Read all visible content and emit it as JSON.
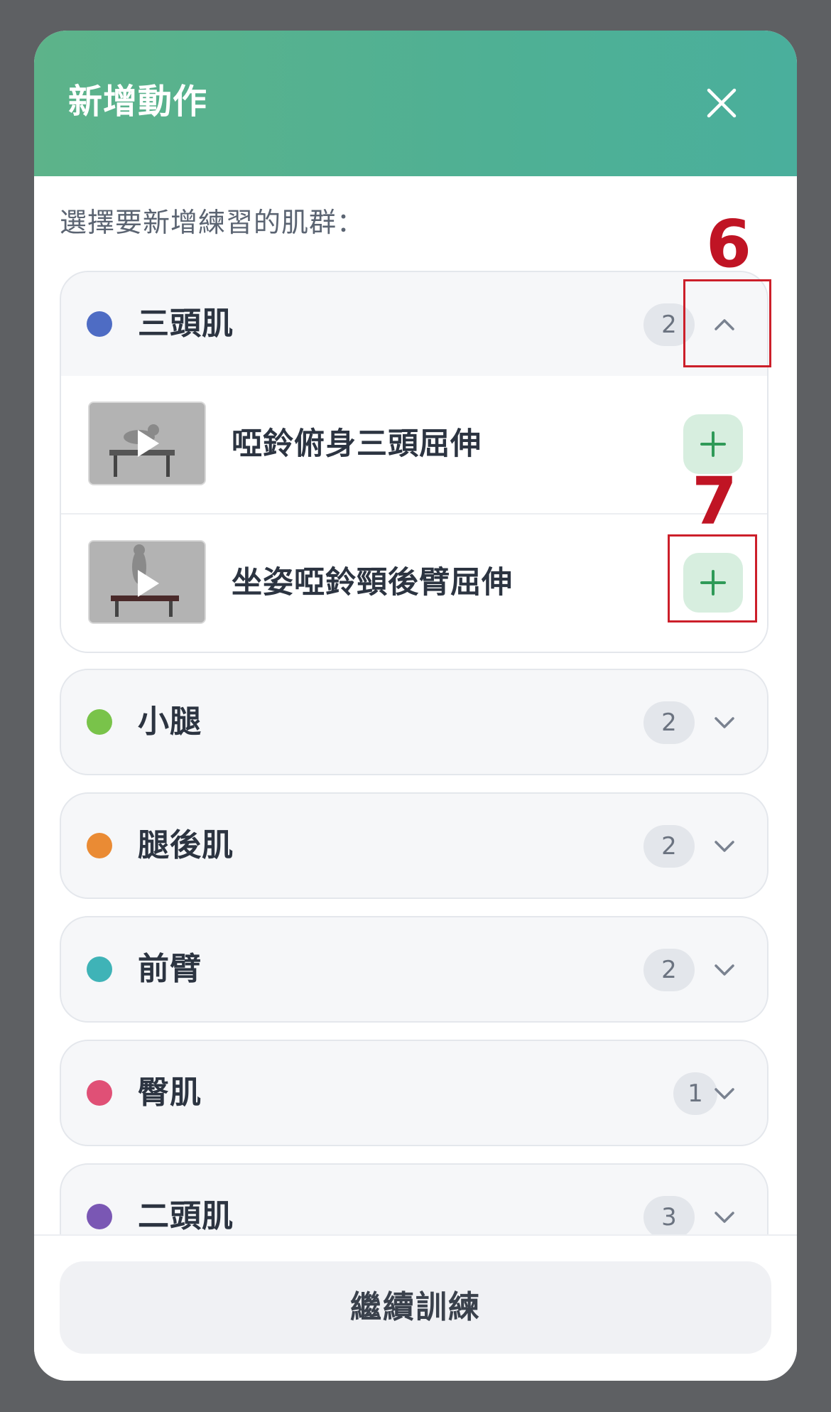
{
  "header": {
    "title": "新增動作",
    "close_icon": "close-icon",
    "gradient_start": "#5db38a",
    "gradient_end": "#4aaf9c"
  },
  "subtitle": "選擇要新增練習的肌群：",
  "groups": [
    {
      "name": "三頭肌",
      "count": "2",
      "color": "#4e6cc4",
      "expanded": true,
      "exercises": [
        {
          "name": "啞鈴俯身三頭屈伸",
          "thumbnail_icon": "play-icon",
          "action_icon": "plus-icon"
        },
        {
          "name": "坐姿啞鈴頸後臂屈伸",
          "thumbnail_icon": "play-icon",
          "action_icon": "plus-icon"
        }
      ]
    },
    {
      "name": "小腿",
      "count": "2",
      "color": "#79c34a",
      "expanded": false
    },
    {
      "name": "腿後肌",
      "count": "2",
      "color": "#ea8b34",
      "expanded": false
    },
    {
      "name": "前臂",
      "count": "2",
      "color": "#3fb3b7",
      "expanded": false
    },
    {
      "name": "臀肌",
      "count": "1",
      "color": "#e05076",
      "expanded": false
    },
    {
      "name": "二頭肌",
      "count": "3",
      "color": "#7a57b4",
      "expanded": false
    }
  ],
  "annotations": [
    {
      "label": "6",
      "target": "collapse-chevron"
    },
    {
      "label": "7",
      "target": "add-exercise-button"
    }
  ],
  "footer": {
    "continue_label": "繼續訓練"
  },
  "accent_color": "#4fb094",
  "annotation_color": "#c01424"
}
